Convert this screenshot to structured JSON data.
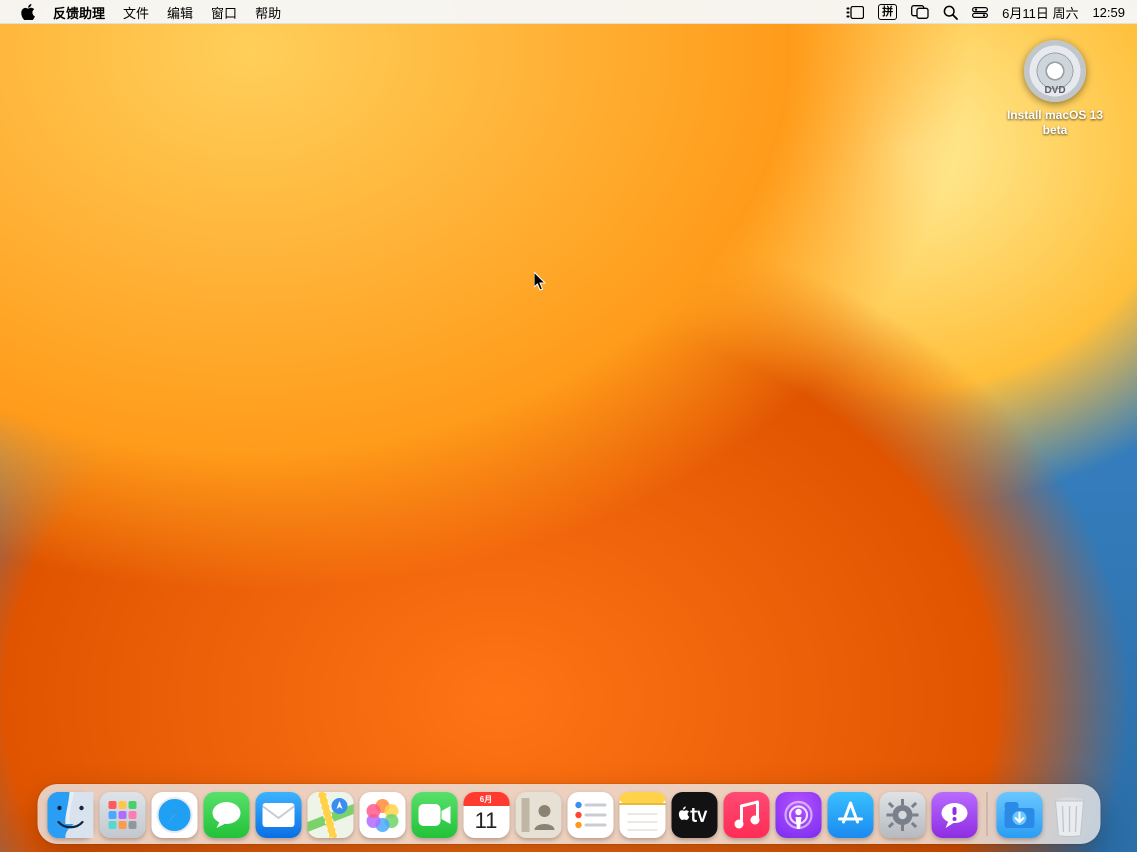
{
  "menubar": {
    "app_name": "反馈助理",
    "items": [
      "文件",
      "编辑",
      "窗口",
      "帮助"
    ],
    "date": "6月11日 周六",
    "time": "12:59",
    "input_method": "拼"
  },
  "desktop": {
    "icon_label_line1": "Install macOS 13",
    "icon_label_line2": "beta",
    "dvd_brand": "DVD"
  },
  "calendar": {
    "month_short": "6月",
    "day": "11"
  },
  "dock": {
    "items": [
      "finder",
      "launchpad",
      "safari",
      "messages",
      "mail",
      "maps",
      "photos",
      "facetime",
      "calendar",
      "contacts",
      "reminders",
      "notes",
      "appletv",
      "music",
      "podcasts",
      "appstore",
      "settings",
      "feedback"
    ],
    "after_sep": [
      "downloads",
      "trash"
    ]
  }
}
